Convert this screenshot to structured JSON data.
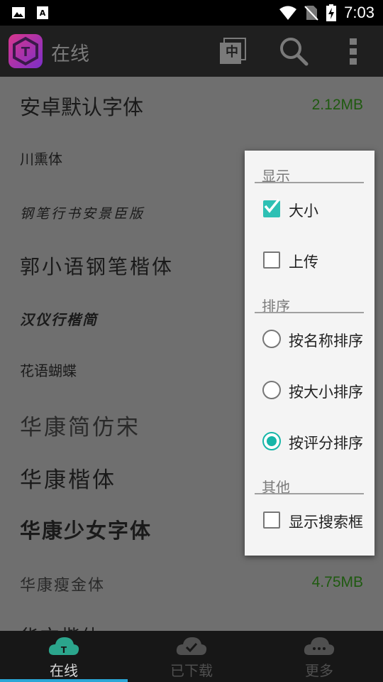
{
  "status_bar": {
    "time": "7:03"
  },
  "app_bar": {
    "title": "在线",
    "lang_button": "中"
  },
  "font_list": [
    {
      "name": "安卓默认字体",
      "size": "2.12MB"
    },
    {
      "name": "川熏体",
      "size": ""
    },
    {
      "name": "钢笔行书安景臣版",
      "size": ""
    },
    {
      "name": "郭小语钢笔楷体",
      "size": ""
    },
    {
      "name": "汉仪行楷简",
      "size": ""
    },
    {
      "name": "花语蝴蝶",
      "size": ""
    },
    {
      "name": "华康简仿宋",
      "size": ""
    },
    {
      "name": "华康楷体",
      "size": ""
    },
    {
      "name": "华康少女字体",
      "size": ""
    },
    {
      "name": "华康瘦金体",
      "size": "4.75MB"
    },
    {
      "name": "华文楷体",
      "size": ""
    }
  ],
  "popup": {
    "display_header": "显示",
    "opt_size": {
      "label": "大小",
      "checked": true
    },
    "opt_upload": {
      "label": "上传",
      "checked": false
    },
    "sort_header": "排序",
    "sort_by_name": {
      "label": "按名称排序",
      "selected": false
    },
    "sort_by_size": {
      "label": "按大小排序",
      "selected": false
    },
    "sort_by_rating": {
      "label": "按评分排序",
      "selected": true
    },
    "other_header": "其他",
    "opt_show_search": {
      "label": "显示搜索框",
      "checked": false
    }
  },
  "bottom_nav": [
    {
      "label": "在线",
      "active": true
    },
    {
      "label": "已下载",
      "active": false
    },
    {
      "label": "更多",
      "active": false
    }
  ],
  "colors": {
    "accent": "#16b6a8",
    "nav_indicator": "#2aa7d6",
    "size_text": "#1f5a10"
  }
}
